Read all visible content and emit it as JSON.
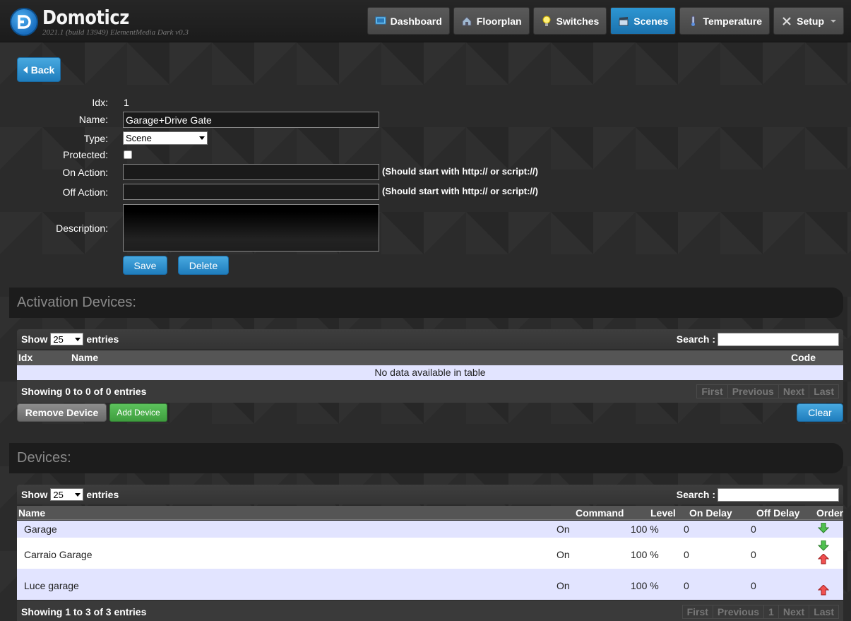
{
  "header": {
    "brand": "Domoticz",
    "version": "2021.1 (build 13949) ElementMedia Dark v0.3",
    "nav": [
      {
        "label": "Dashboard",
        "icon": "monitor-icon",
        "active": false
      },
      {
        "label": "Floorplan",
        "icon": "house-icon",
        "active": false
      },
      {
        "label": "Switches",
        "icon": "bulb-icon",
        "active": false
      },
      {
        "label": "Scenes",
        "icon": "clapper-icon",
        "active": true
      },
      {
        "label": "Temperature",
        "icon": "thermometer-icon",
        "active": false
      },
      {
        "label": "Setup",
        "icon": "tools-icon",
        "active": false
      }
    ]
  },
  "form": {
    "back_label": "Back",
    "idx_label": "Idx:",
    "idx_value": "1",
    "name_label": "Name:",
    "name_value": "Garage+Drive Gate",
    "type_label": "Type:",
    "type_value": "Scene",
    "protected_label": "Protected:",
    "protected_checked": false,
    "on_action_label": "On Action:",
    "on_action_value": "",
    "off_action_label": "Off Action:",
    "off_action_value": "",
    "action_hint": "(Should start with http:// or script://)",
    "description_label": "Description:",
    "save_label": "Save",
    "delete_label": "Delete"
  },
  "activation": {
    "title": "Activation Devices:",
    "show_label": "Show",
    "entries_count": "25",
    "entries_label": "entries",
    "search_label": "Search :",
    "columns": [
      "Idx",
      "Name",
      "Code"
    ],
    "empty_text": "No data available in table",
    "info": "Showing 0 to 0 of 0 entries",
    "pager": [
      "First",
      "Previous",
      "Next",
      "Last"
    ],
    "remove_label": "Remove Device",
    "add_label": "Add Device",
    "clear_label": "Clear"
  },
  "devices": {
    "title": "Devices:",
    "show_label": "Show",
    "entries_count": "25",
    "entries_label": "entries",
    "search_label": "Search :",
    "columns": [
      "Name",
      "Command",
      "Level",
      "On Delay",
      "Off Delay",
      "Order"
    ],
    "rows": [
      {
        "name": "Garage",
        "command": "On",
        "level": "100 %",
        "on_delay": "0",
        "off_delay": "0",
        "order": [
          "down"
        ]
      },
      {
        "name": "Carraio Garage",
        "command": "On",
        "level": "100 %",
        "on_delay": "0",
        "off_delay": "0",
        "order": [
          "down",
          "up"
        ]
      },
      {
        "name": "Luce garage",
        "command": "On",
        "level": "100 %",
        "on_delay": "0",
        "off_delay": "0",
        "order": [
          "up"
        ]
      }
    ],
    "info": "Showing 1 to 3 of 3 entries",
    "pager": [
      "First",
      "Previous",
      "1",
      "Next",
      "Last"
    ]
  }
}
